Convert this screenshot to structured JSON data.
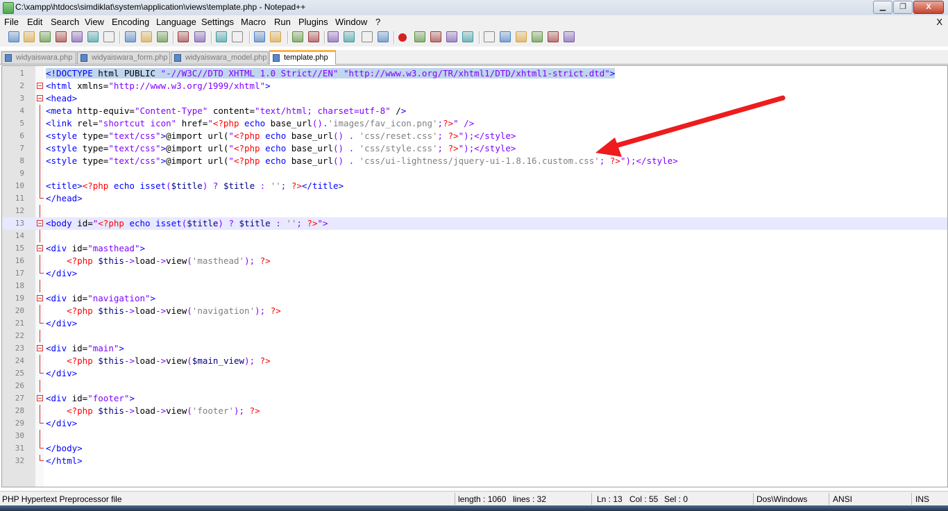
{
  "window": {
    "title": "C:\\xampp\\htdocs\\simdiklat\\system\\application\\views\\template.php - Notepad++",
    "buttons": {
      "minimize": "▁",
      "maximize": "❐",
      "close": "X"
    }
  },
  "menu": {
    "items": [
      "File",
      "Edit",
      "Search",
      "View",
      "Encoding",
      "Language",
      "Settings",
      "Macro",
      "Run",
      "Plugins",
      "Window",
      "?"
    ],
    "close": "X"
  },
  "tabs": [
    {
      "label": "widyaiswara.php",
      "active": false
    },
    {
      "label": "widyaiswara_form.php",
      "active": false
    },
    {
      "label": "widyaiswara_model.php",
      "active": false
    },
    {
      "label": "template.php",
      "active": true
    }
  ],
  "editor": {
    "current_line": 13,
    "lines": [
      "<!DOCTYPE html PUBLIC \"-//W3C//DTD XHTML 1.0 Strict//EN\" \"http://www.w3.org/TR/xhtml1/DTD/xhtml1-strict.dtd\">",
      "<html xmlns=\"http://www.w3.org/1999/xhtml\">",
      "<head>",
      "<meta http-equiv=\"Content-Type\" content=\"text/html; charset=utf-8\" />",
      "<link rel=\"shortcut icon\" href=\"<?php echo base_url().'images/fav_icon.png';?>\" />",
      "<style type=\"text/css\">@import url(\"<?php echo base_url() . 'css/reset.css'; ?>\");</style>",
      "<style type=\"text/css\">@import url(\"<?php echo base_url() . 'css/style.css'; ?>\");</style>",
      "<style type=\"text/css\">@import url(\"<?php echo base_url() . 'css/ui-lightness/jquery-ui-1.8.16.custom.css'; ?>\");</style>",
      "",
      "<title><?php echo isset($title) ? $title : ''; ?></title>",
      "</head>",
      "",
      "<body id=\"<?php echo isset($title) ? $title : ''; ?>\">",
      "",
      "<div id=\"masthead\">",
      "    <?php $this->load->view('masthead'); ?>",
      "</div>",
      "",
      "<div id=\"navigation\">",
      "    <?php $this->load->view('navigation'); ?>",
      "</div>",
      "",
      "<div id=\"main\">",
      "    <?php $this->load->view($main_view); ?>",
      "</div>",
      "",
      "<div id=\"footer\">",
      "    <?php $this->load->view('footer'); ?>",
      "</div>",
      "",
      "</body>",
      "</html>"
    ]
  },
  "status": {
    "file_type": "PHP Hypertext Preprocessor file",
    "length": "length : 1060",
    "lines": "lines : 32",
    "ln": "Ln : 13",
    "col": "Col : 55",
    "sel": "Sel : 0",
    "eol": "Dos\\Windows",
    "encoding": "ANSI",
    "mode": "INS"
  },
  "colors": {
    "tag": "#0000ff",
    "attribute": "#ff0000",
    "string": "#8000ff",
    "php_delim": "#ff0000",
    "php_keyword": "#0000ff",
    "php_string": "#808080",
    "selection": "#c0d6ee",
    "current_line": "#e8e8ff",
    "arrow": "#ee1c1c",
    "active_tab_accent": "#fab14b"
  },
  "toolbar": {
    "icons": [
      "new-file-icon",
      "open-file-icon",
      "save-icon",
      "save-all-icon",
      "close-icon",
      "close-all-icon",
      "print-icon",
      "cut-icon",
      "copy-icon",
      "paste-icon",
      "undo-icon",
      "redo-icon",
      "find-icon",
      "replace-icon",
      "zoom-in-icon",
      "zoom-out-icon",
      "sync-vertical-icon",
      "sync-horizontal-icon",
      "word-wrap-icon",
      "show-all-chars-icon",
      "indent-guide-icon",
      "user-lang-icon",
      "record-macro-icon",
      "stop-macro-icon",
      "play-macro-icon",
      "run-macro-multiple-icon",
      "save-macro-icon",
      "fold-all-icon",
      "collapse-icon",
      "expand-icon",
      "unfold-all-icon",
      "spellcheck-icon",
      "abc-check-icon"
    ]
  }
}
